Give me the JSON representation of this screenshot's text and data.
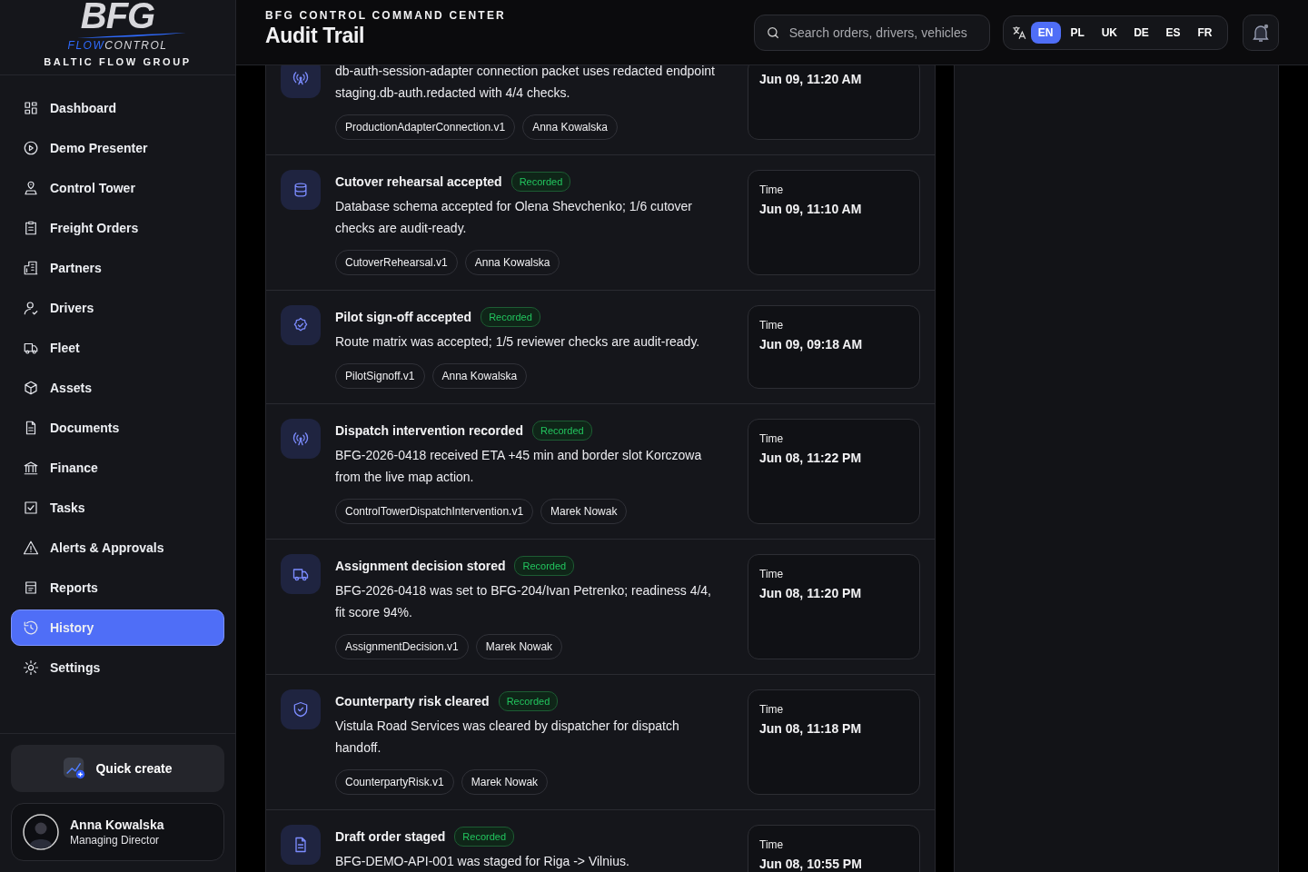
{
  "logo": {
    "mark": "BFG",
    "sub_accent": "FLOW",
    "sub_rest": "CONTROL",
    "tagline": "BALTIC FLOW GROUP"
  },
  "sidebar": {
    "items": [
      {
        "label": "Dashboard",
        "selected": false
      },
      {
        "label": "Demo Presenter",
        "selected": false
      },
      {
        "label": "Control Tower",
        "selected": false
      },
      {
        "label": "Freight Orders",
        "selected": false
      },
      {
        "label": "Partners",
        "selected": false
      },
      {
        "label": "Drivers",
        "selected": false
      },
      {
        "label": "Fleet",
        "selected": false
      },
      {
        "label": "Assets",
        "selected": false
      },
      {
        "label": "Documents",
        "selected": false
      },
      {
        "label": "Finance",
        "selected": false
      },
      {
        "label": "Tasks",
        "selected": false
      },
      {
        "label": "Alerts & Approvals",
        "selected": false
      },
      {
        "label": "Reports",
        "selected": false
      },
      {
        "label": "History",
        "selected": true
      },
      {
        "label": "Settings",
        "selected": false
      }
    ],
    "quick_create": "Quick create",
    "user": {
      "name": "Anna Kowalska",
      "role": "Managing Director"
    }
  },
  "header": {
    "eyebrow": "BFG CONTROL COMMAND CENTER",
    "title": "Audit Trail",
    "search": {
      "placeholder": "Search orders, drivers, vehicles"
    },
    "languages": [
      {
        "label": "EN",
        "selected": true
      },
      {
        "label": "PL",
        "selected": false
      },
      {
        "label": "UK",
        "selected": false
      },
      {
        "label": "DE",
        "selected": false
      },
      {
        "label": "ES",
        "selected": false
      },
      {
        "label": "FR",
        "selected": false
      }
    ]
  },
  "events": [
    {
      "description": "db-auth-session-adapter connection packet uses redacted endpoint staging.db-auth.redacted with 4/4 checks.",
      "tags": [
        "ProductionAdapterConnection.v1",
        "Anna Kowalska"
      ],
      "time": "Jun 09, 11:20 AM"
    },
    {
      "title": "Cutover rehearsal accepted",
      "status": "Recorded",
      "description": "Database schema accepted for Olena Shevchenko; 1/6 cutover checks are audit-ready.",
      "tags": [
        "CutoverRehearsal.v1",
        "Anna Kowalska"
      ],
      "time_label": "Time",
      "time": "Jun 09, 11:10 AM"
    },
    {
      "title": "Pilot sign-off accepted",
      "status": "Recorded",
      "description": "Route matrix was accepted; 1/5 reviewer checks are audit-ready.",
      "tags": [
        "PilotSignoff.v1",
        "Anna Kowalska"
      ],
      "time_label": "Time",
      "time": "Jun 09, 09:18 AM"
    },
    {
      "title": "Dispatch intervention recorded",
      "status": "Recorded",
      "description": "BFG-2026-0418 received ETA +45 min and border slot Korczowa from the live map action.",
      "tags": [
        "ControlTowerDispatchIntervention.v1",
        "Marek Nowak"
      ],
      "time_label": "Time",
      "time": "Jun 08, 11:22 PM"
    },
    {
      "title": "Assignment decision stored",
      "status": "Recorded",
      "description": "BFG-2026-0418 was set to BFG-204/Ivan Petrenko; readiness 4/4, fit score 94%.",
      "tags": [
        "AssignmentDecision.v1",
        "Marek Nowak"
      ],
      "time_label": "Time",
      "time": "Jun 08, 11:20 PM"
    },
    {
      "title": "Counterparty risk cleared",
      "status": "Recorded",
      "description": "Vistula Road Services was cleared by dispatcher for dispatch handoff.",
      "tags": [
        "CounterpartyRisk.v1",
        "Marek Nowak"
      ],
      "time_label": "Time",
      "time": "Jun 08, 11:18 PM"
    },
    {
      "title": "Draft order staged",
      "status": "Recorded",
      "description": "BFG-DEMO-API-001 was staged for Riga -> Vilnius.",
      "time_label": "Time",
      "time": "Jun 08, 10:55 PM"
    }
  ]
}
